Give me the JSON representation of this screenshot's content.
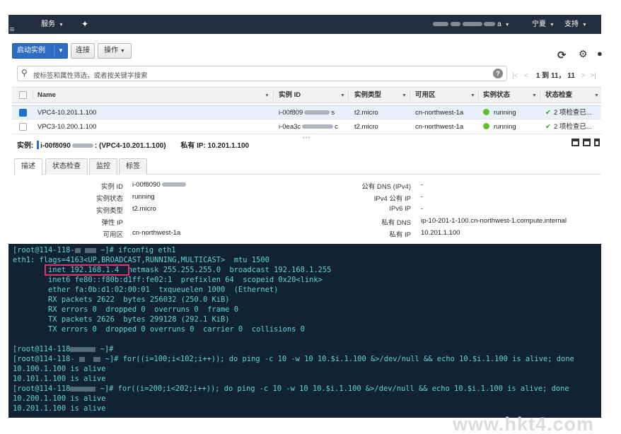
{
  "topnav": {
    "services": "服务",
    "account": "a",
    "region": "宁夏",
    "support": "支持"
  },
  "toolbar": {
    "launch": "启动实例",
    "connect": "连接",
    "actions": "操作",
    "refresh_icon": "refresh-icon",
    "settings_icon": "gear-icon"
  },
  "search": {
    "placeholder": "按标签和属性筛选，或者按关键字搜索",
    "pager": "1 到 11， 11"
  },
  "table": {
    "columns": [
      "Name",
      "实例 ID",
      "实例类型",
      "可用区",
      "实例状态",
      "状态检查"
    ],
    "rows": [
      {
        "name": "VPC4-10.201.1.100",
        "id": "i-00f809",
        "id_tail": "s",
        "type": "t2.micro",
        "az": "cn-northwest-1a",
        "state": "running",
        "check": "2 项检查已...",
        "selected": true
      },
      {
        "name": "VPC3-10.200.1.100",
        "id": "i-0ea3c",
        "id_tail": "c",
        "type": "t2.micro",
        "az": "cn-northwest-1a",
        "state": "running",
        "check": "2 项检查已...",
        "selected": false
      }
    ]
  },
  "details": {
    "instance_label": "实例:",
    "instance_id": "i-00f8090",
    "instance_suffix": ": (VPC4-10.201.1.100)",
    "private_ip_label": "私有 IP: 10.201.1.100",
    "tabs": [
      "描述",
      "状态检查",
      "监控",
      "标签"
    ],
    "left": [
      {
        "label": "实例 ID",
        "value": "i-00f8090"
      },
      {
        "label": "实例状态",
        "value": "running"
      },
      {
        "label": "实例类型",
        "value": "t2.micro"
      },
      {
        "label": "弹性 IP",
        "value": ""
      },
      {
        "label": "可用区",
        "value": "cn-northwest-1a"
      }
    ],
    "right": [
      {
        "label": "公有 DNS (IPv4)",
        "value": "-"
      },
      {
        "label": "IPv4 公有 IP",
        "value": "-"
      },
      {
        "label": "IPv6 IP",
        "value": "-"
      },
      {
        "label": "私有 DNS",
        "value": "ip-10-201-1-100.cn-northwest-1.compute.internal"
      },
      {
        "label": "私有 IP",
        "value": "10.201.1.100"
      }
    ]
  },
  "terminal": {
    "l1a": "[root@114-118-",
    "l1b": " ~]# ifconfig eth1",
    "l2": "eth1: flags=4163<UP,BROADCAST,RUNNING,MULTICAST>  mtu 1500",
    "l3": "        inet 192.168.1.4  netmask 255.255.255.0  broadcast 192.168.1.255",
    "l4": "        inet6 fe80::f80b:d1ff:fe02:1  prefixlen 64  scopeid 0x20<link>",
    "l5": "        ether fa:0b:d1:02:00:01  txqueuelen 1000  (Ethernet)",
    "l6": "        RX packets 2622  bytes 256032 (250.0 KiB)",
    "l7": "        RX errors 0  dropped 0  overruns 0  frame 0",
    "l8": "        TX packets 2626  bytes 299128 (292.1 KiB)",
    "l9": "        TX errors 0  dropped 0 overruns 0  carrier 0  collisions 0",
    "l10a": "[root@114-118",
    "l10b": " ~]#",
    "l11a": "[root@114-118-",
    "l11b": " ~]# for((i=100;i<102;i++)); do ping -c 10 -w 10 10.$i.1.100 &>/dev/null && echo 10.$i.1.100 is alive; done",
    "l12": "10.100.1.100 is alive",
    "l13": "10.101.1.100 is alive",
    "l14a": "[root@114-118",
    "l14b": " ~]# for((i=200;i<202;i++)); do ping -c 10 -w 10 10.$i.1.100 &>/dev/null && echo 10.$i.1.100 is alive; done",
    "l15": "10.200.1.100 is alive",
    "l16": "10.201.1.100 is alive"
  },
  "watermark": "www.hkt4.com"
}
